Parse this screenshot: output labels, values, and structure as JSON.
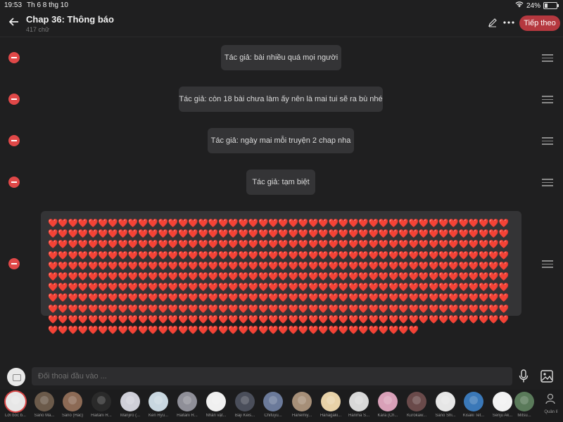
{
  "status_bar": {
    "time": "19:53",
    "date": "Th 6 8 thg 10",
    "battery": "24%"
  },
  "header": {
    "title": "Chap 36: Thông báo",
    "subtitle": "417 chữ",
    "next_label": "Tiếp theo"
  },
  "messages": [
    {
      "text": "Tác giả: bài nhiều quá mọi người"
    },
    {
      "text": "Tác giả: còn 18 bài chưa làm ấy nên là mai tui sẽ ra bù nhé"
    },
    {
      "text": "Tác giả: ngày mai mỗi truyện 2 chap nha"
    },
    {
      "text": "Tác giả: tạm biệt"
    },
    {
      "text": "❤️❤️❤️❤️❤️❤️❤️❤️❤️❤️❤️❤️❤️❤️❤️❤️❤️❤️❤️❤️❤️❤️❤️❤️❤️❤️❤️❤️❤️❤️❤️❤️❤️❤️❤️❤️❤️❤️❤️❤️❤️❤️❤️❤️❤️❤️❤️❤️❤️❤️❤️❤️❤️❤️❤️❤️❤️❤️❤️❤️❤️❤️❤️❤️❤️❤️❤️❤️❤️❤️❤️❤️❤️❤️❤️❤️❤️❤️❤️❤️❤️❤️❤️❤️❤️❤️❤️❤️❤️❤️❤️❤️❤️❤️❤️❤️❤️❤️❤️❤️❤️❤️❤️❤️❤️❤️❤️❤️❤️❤️❤️❤️❤️❤️❤️❤️❤️❤️❤️❤️❤️❤️❤️❤️❤️❤️❤️❤️❤️❤️❤️❤️❤️❤️❤️❤️❤️❤️❤️❤️❤️❤️❤️❤️❤️❤️❤️❤️❤️❤️❤️❤️❤️❤️❤️❤️❤️❤️❤️❤️❤️❤️❤️❤️❤️❤️❤️❤️❤️❤️❤️❤️❤️❤️❤️❤️❤️❤️❤️❤️❤️❤️❤️❤️❤️❤️❤️❤️❤️❤️❤️❤️❤️❤️❤️❤️❤️❤️❤️❤️❤️❤️❤️❤️❤️❤️❤️❤️❤️❤️❤️❤️❤️❤️❤️❤️❤️❤️❤️❤️❤️❤️❤️❤️❤️❤️❤️❤️❤️❤️❤️❤️❤️❤️❤️❤️❤️❤️❤️❤️❤️❤️❤️❤️❤️❤️❤️❤️❤️❤️❤️❤️❤️❤️❤️❤️❤️❤️❤️❤️❤️❤️❤️❤️❤️❤️❤️❤️❤️❤️❤️❤️❤️❤️❤️❤️❤️❤️❤️❤️❤️❤️❤️❤️❤️❤️❤️❤️❤️❤️❤️❤️❤️❤️❤️❤️❤️❤️❤️❤️❤️❤️❤️❤️❤️❤️❤️❤️❤️❤️❤️❤️❤️❤️❤️❤️❤️❤️❤️❤️❤️❤️❤️❤️❤️❤️❤️❤️❤️❤️❤️❤️❤️❤️❤️❤️❤️❤️❤️❤️❤️❤️❤️❤️❤️❤️❤️❤️❤️❤️❤️❤️❤️❤️❤️❤️❤️❤️❤️❤️❤️❤️❤️❤️❤️❤️❤️❤️❤️❤️❤️❤️❤️❤️❤️❤️❤️❤️❤️❤️❤️❤️❤️❤️❤️❤️❤️❤️❤️❤️❤️❤️❤️❤️❤️❤️❤️❤️❤️❤️❤️❤️❤️❤️❤️❤️❤️❤️❤️❤️❤️❤️❤️❤️❤️❤️❤️❤️❤️❤️❤️❤️❤️❤️❤️❤️❤️❤️❤️❤️❤️❤️❤️❤️❤️❤️❤️❤️❤️❤️❤️❤️❤️❤️❤️❤️❤️❤️❤️❤️❤️❤️❤️❤️❤️❤️❤️❤️❤️❤️❤️❤️❤️❤️❤️❤️❤️❤️❤️❤️❤️❤️❤️❤️❤️❤️❤️❤️❤️❤️❤️❤️❤️❤️❤️❤️❤️❤️❤️❤️❤️❤️❤️❤️❤️❤️❤️"
    }
  ],
  "input": {
    "placeholder": "Đối thoại đầu vào ..."
  },
  "characters": [
    {
      "name": "Lời bóc b...",
      "color": "#d9d9d9"
    },
    {
      "name": "Sano Ma...",
      "color": "#6b5a4a"
    },
    {
      "name": "Sano (Hắc)",
      "color": "#8c6a55"
    },
    {
      "name": "Haitani R...",
      "color": "#2a2a2a"
    },
    {
      "name": "Manjiro (...",
      "color": "#cfcfd8"
    },
    {
      "name": "Ken Ryu...",
      "color": "#c9d7e0"
    },
    {
      "name": "Haitani R...",
      "color": "#8f8f98"
    },
    {
      "name": "Nhân vật...",
      "color": "#f0f0f0"
    },
    {
      "name": "Baji Keis...",
      "color": "#4a4e5a"
    },
    {
      "name": "Chifuyu...",
      "color": "#6b7a9a"
    },
    {
      "name": "Hanemiy...",
      "color": "#a68f78"
    },
    {
      "name": "Hanagaki...",
      "color": "#e8d2a8"
    },
    {
      "name": "Hanma S...",
      "color": "#d8d8d8"
    },
    {
      "name": "Kara (Ch...",
      "color": "#d9a0b8"
    },
    {
      "name": "Kurokaw...",
      "color": "#6a4a4a"
    },
    {
      "name": "Sano Shi...",
      "color": "#e6e6e6"
    },
    {
      "name": "Kisaki Tet...",
      "color": "#3a78b8"
    },
    {
      "name": "Senju Ak...",
      "color": "#f2f2f2"
    },
    {
      "name": "Mitsu...",
      "color": "#5a7a5a"
    }
  ],
  "manage_label": "Quản lí"
}
